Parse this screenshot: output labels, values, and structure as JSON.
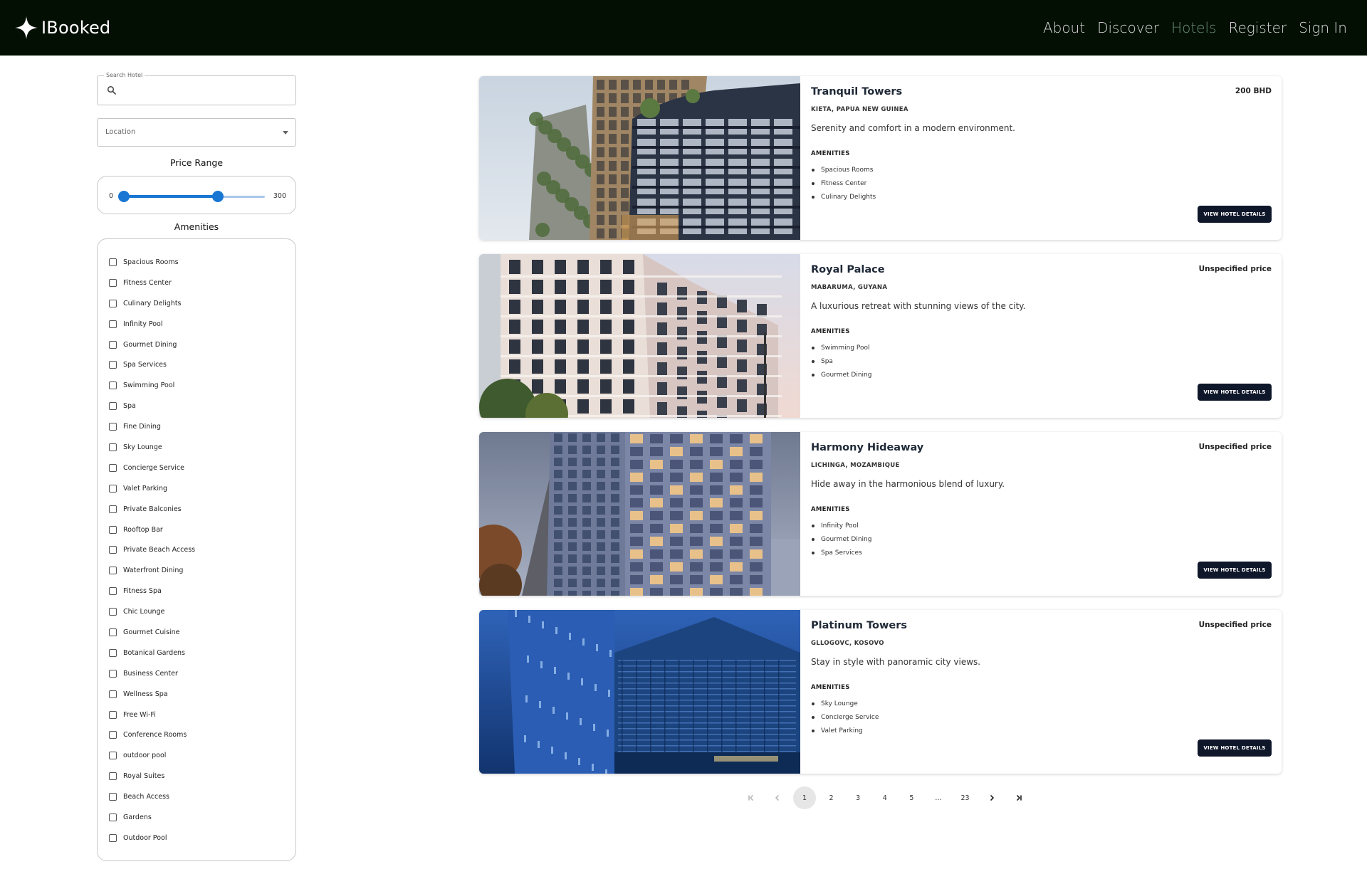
{
  "app": {
    "brand": "IBooked"
  },
  "nav": {
    "items": [
      {
        "label": "About",
        "active": false
      },
      {
        "label": "Discover",
        "active": false
      },
      {
        "label": "Hotels",
        "active": true
      },
      {
        "label": "Register",
        "active": false
      },
      {
        "label": "Sign In",
        "active": false
      }
    ]
  },
  "filters": {
    "search": {
      "label": "Search Hotel",
      "value": "",
      "icon": "search-icon"
    },
    "location": {
      "label": "Location",
      "icon": "chevron-down-icon"
    },
    "price": {
      "title": "Price Range",
      "min": "0",
      "max": "300",
      "range_min": 0,
      "range_max": 300,
      "low_value": 0,
      "high_value": 200
    },
    "amenities_title": "Amenities",
    "amenities": [
      "Spacious Rooms",
      "Fitness Center",
      "Culinary Delights",
      "Infinity Pool",
      "Gourmet Dining",
      "Spa Services",
      "Swimming Pool",
      "Spa",
      "Fine Dining",
      "Sky Lounge",
      "Concierge Service",
      "Valet Parking",
      "Private Balconies",
      "Rooftop Bar",
      "Private Beach Access",
      "Waterfront Dining",
      "Fitness Spa",
      "Chic Lounge",
      "Gourmet Cuisine",
      "Botanical Gardens",
      "Business Center",
      "Wellness Spa",
      "Free Wi-Fi",
      "Conference Rooms",
      "outdoor pool",
      "Royal Suites",
      "Beach Access",
      "Gardens",
      "Outdoor Pool"
    ]
  },
  "hotels": [
    {
      "name": "Tranquil Towers",
      "price": "200 BHD",
      "location": "KIETA, PAPUA NEW GUINEA",
      "description": "Serenity and comfort in a modern environment.",
      "amenities_heading": "AMENITIES",
      "amenities": [
        "Spacious Rooms",
        "Fitness Center",
        "Culinary Delights"
      ],
      "button": "VIEW HOTEL DETAILS",
      "image_style": "green-facade-tower"
    },
    {
      "name": "Royal Palace",
      "price": "Unspecified price",
      "location": "MABARUMA, GUYANA",
      "description": "A luxurious retreat with stunning views of the city.",
      "amenities_heading": "AMENITIES",
      "amenities": [
        "Swimming Pool",
        "Spa",
        "Gourmet Dining"
      ],
      "button": "VIEW HOTEL DETAILS",
      "image_style": "white-grid-building"
    },
    {
      "name": "Harmony Hideaway",
      "price": "Unspecified price",
      "location": "LICHINGA, MOZAMBIQUE",
      "description": "Hide away in the harmonious blend of luxury.",
      "amenities_heading": "AMENITIES",
      "amenities": [
        "Infinity Pool",
        "Gourmet Dining",
        "Spa Services"
      ],
      "button": "VIEW HOTEL DETAILS",
      "image_style": "glass-grid-tower"
    },
    {
      "name": "Platinum Towers",
      "price": "Unspecified price",
      "location": "GLLOGOVC, KOSOVO",
      "description": "Stay in style with panoramic city views.",
      "amenities_heading": "AMENITIES",
      "amenities": [
        "Sky Lounge",
        "Concierge Service",
        "Valet Parking"
      ],
      "button": "VIEW HOTEL DETAILS",
      "image_style": "blue-glass-skyscrapers"
    }
  ],
  "pagination": {
    "pages": [
      "1",
      "2",
      "3",
      "4",
      "5",
      "…",
      "23"
    ],
    "current": "1",
    "first_icon": "first-page-icon",
    "prev_icon": "chevron-left-icon",
    "next_icon": "chevron-right-icon",
    "last_icon": "last-page-icon"
  }
}
